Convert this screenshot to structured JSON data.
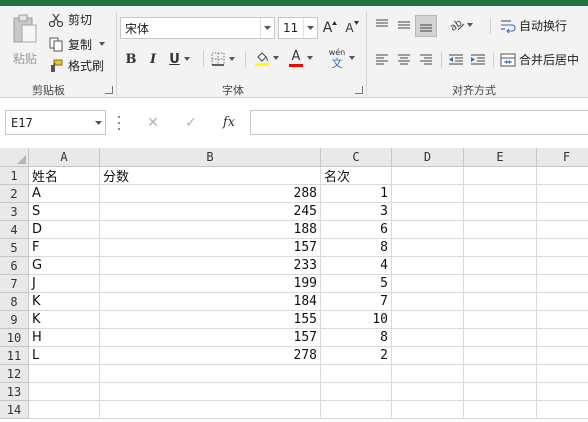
{
  "ribbon": {
    "clipboard": {
      "paste_label": "粘贴",
      "cut_label": "剪切",
      "copy_label": "复制",
      "format_painter_label": "格式刷",
      "group_label": "剪贴板"
    },
    "font": {
      "font_name": "宋体",
      "font_size": "11",
      "increase_size_glyph": "A",
      "decrease_size_glyph": "A",
      "bold_glyph": "B",
      "italic_glyph": "I",
      "underline_glyph": "U",
      "font_color_glyph": "A",
      "phonetic_top": "wén",
      "phonetic_bottom": "文",
      "group_label": "字体"
    },
    "alignment": {
      "wrap_text_label": "自动换行",
      "merge_center_label": "合并后居中",
      "group_label": "对齐方式"
    },
    "colors": {
      "accent": "#217346",
      "font_color_bar": "#ff0000",
      "fill_color_bar": "#ffff00",
      "wrap_icon_blue": "#2b6cc4"
    }
  },
  "formula_bar": {
    "name_box_value": "E17",
    "cancel_glyph": "✕",
    "enter_glyph": "✓",
    "fx_glyph": "fx",
    "formula_value": ""
  },
  "sheet": {
    "columns": [
      "A",
      "B",
      "C",
      "D",
      "E",
      "F"
    ],
    "rows": [
      {
        "n": "1",
        "a": "姓名",
        "b": "分数",
        "c": "名次"
      },
      {
        "n": "2",
        "a": "A",
        "b": "288",
        "c": "1"
      },
      {
        "n": "3",
        "a": "S",
        "b": "245",
        "c": "3"
      },
      {
        "n": "4",
        "a": "D",
        "b": "188",
        "c": "6"
      },
      {
        "n": "5",
        "a": "F",
        "b": "157",
        "c": "8"
      },
      {
        "n": "6",
        "a": "G",
        "b": "233",
        "c": "4"
      },
      {
        "n": "7",
        "a": "J",
        "b": "199",
        "c": "5"
      },
      {
        "n": "8",
        "a": "K",
        "b": "184",
        "c": "7"
      },
      {
        "n": "9",
        "a": "K",
        "b": "155",
        "c": "10"
      },
      {
        "n": "10",
        "a": "H",
        "b": "157",
        "c": "8"
      },
      {
        "n": "11",
        "a": "L",
        "b": "278",
        "c": "2"
      },
      {
        "n": "12",
        "a": "",
        "b": "",
        "c": ""
      },
      {
        "n": "13",
        "a": "",
        "b": "",
        "c": ""
      },
      {
        "n": "14",
        "a": "",
        "b": "",
        "c": ""
      }
    ]
  }
}
